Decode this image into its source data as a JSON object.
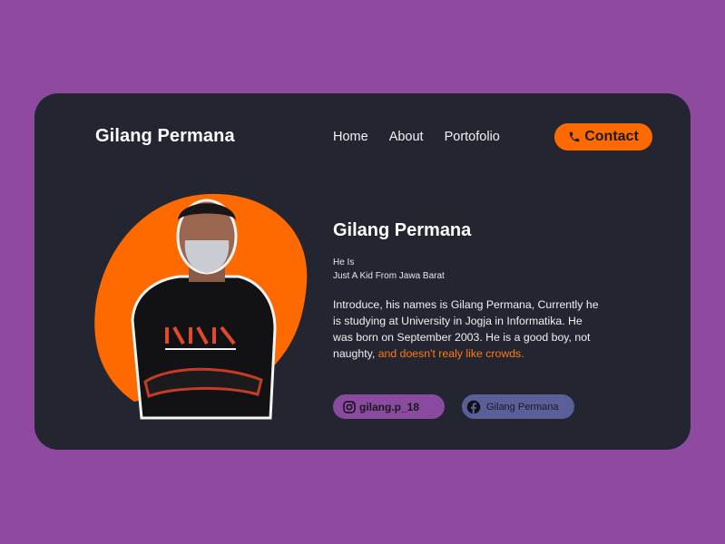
{
  "header": {
    "brand": "Gilang Permana",
    "nav": [
      "Home",
      "About",
      "Portofolio"
    ],
    "contact_label": "Contact"
  },
  "profile": {
    "name": "Gilang Permana",
    "subtitle_1": "He Is",
    "subtitle_2": "Just A Kid From Jawa Barat",
    "intro_plain": "Introduce, his names is Gilang Permana, Currently he is studying at University in Jogja in Informatika. He was born on September 2003. He is a good boy, not naughty,",
    "intro_highlight": "and doesn't realy like crowds."
  },
  "socials": {
    "instagram": "gilang.p_18",
    "facebook": "Gilang Permana"
  },
  "colors": {
    "background": "#8e4a9f",
    "card": "#232631",
    "accent": "#ff6a00",
    "instagram_pill": "#8a4aa0",
    "facebook_pill": "#5a5f9a"
  },
  "icons": {
    "contact": "phone-icon",
    "instagram": "instagram-icon",
    "facebook": "facebook-icon"
  }
}
